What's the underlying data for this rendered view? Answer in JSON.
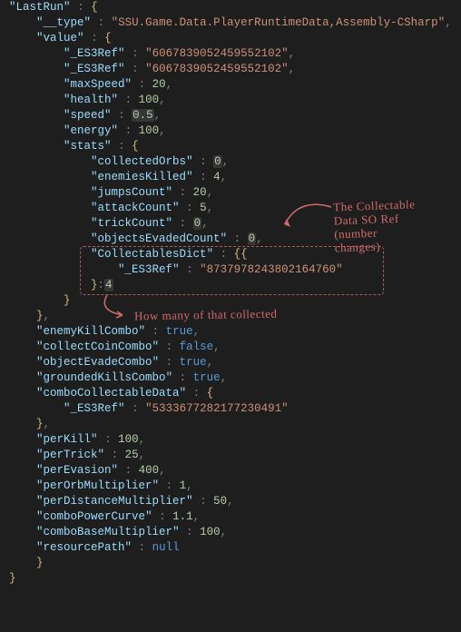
{
  "code": {
    "rootKey": "LastRun",
    "typeKey": "__type",
    "typeVal": "SSU.Game.Data.PlayerRuntimeData,Assembly-CSharp",
    "valueKey": "value",
    "es3a_key": "_ES3Ref",
    "es3a_val": "6067839052459552102",
    "es3b_key": "_ES3Ref",
    "es3b_val": "6067839052459552102",
    "maxSpeed_k": "maxSpeed",
    "maxSpeed_v": "20",
    "health_k": "health",
    "health_v": "100",
    "speed_k": "speed",
    "speed_v": "0.5",
    "energy_k": "energy",
    "energy_v": "100",
    "stats_k": "stats",
    "collectedOrbs_k": "collectedOrbs",
    "collectedOrbs_v": "0",
    "enemiesKilled_k": "enemiesKilled",
    "enemiesKilled_v": "4",
    "jumpsCount_k": "jumpsCount",
    "jumpsCount_v": "20",
    "attackCount_k": "attackCount",
    "attackCount_v": "5",
    "trickCount_k": "trickCount",
    "trickCount_v": "0",
    "objectsEvaded_k": "objectsEvadedCount",
    "objectsEvaded_v": "0",
    "collectablesDict_k": "CollectablesDict",
    "collDict_es3_k": "_ES3Ref",
    "collDict_es3_v": "8737978243802164760",
    "collDict_count": "4",
    "enemyKillCombo_k": "enemyKillCombo",
    "enemyKillCombo_v": "true",
    "collectCoinCombo_k": "collectCoinCombo",
    "collectCoinCombo_v": "false",
    "objectEvadeCombo_k": "objectEvadeCombo",
    "objectEvadeCombo_v": "true",
    "groundedKillsCombo_k": "groundedKillsCombo",
    "groundedKillsCombo_v": "true",
    "comboCollectable_k": "comboCollectableData",
    "comboColl_es3_k": "_ES3Ref",
    "comboColl_es3_v": "5333677282177230491",
    "perKill_k": "perKill",
    "perKill_v": "100",
    "perTrick_k": "perTrick",
    "perTrick_v": "25",
    "perEvasion_k": "perEvasion",
    "perEvasion_v": "400",
    "perOrbMult_k": "perOrbMultiplier",
    "perOrbMult_v": "1",
    "perDistMult_k": "perDistanceMultiplier",
    "perDistMult_v": "50",
    "comboPowerCurve_k": "comboPowerCurve",
    "comboPowerCurve_v": "1.1",
    "comboBaseMult_k": "comboBaseMultiplier",
    "comboBaseMult_v": "100",
    "resourcePath_k": "resourcePath",
    "resourcePath_v": "null"
  },
  "annotations": {
    "soRef1": "The Collectable",
    "soRef2": "Data SO Ref",
    "soRef3": "(number",
    "soRef4": "changes)",
    "howMany": "How many of that collected"
  }
}
